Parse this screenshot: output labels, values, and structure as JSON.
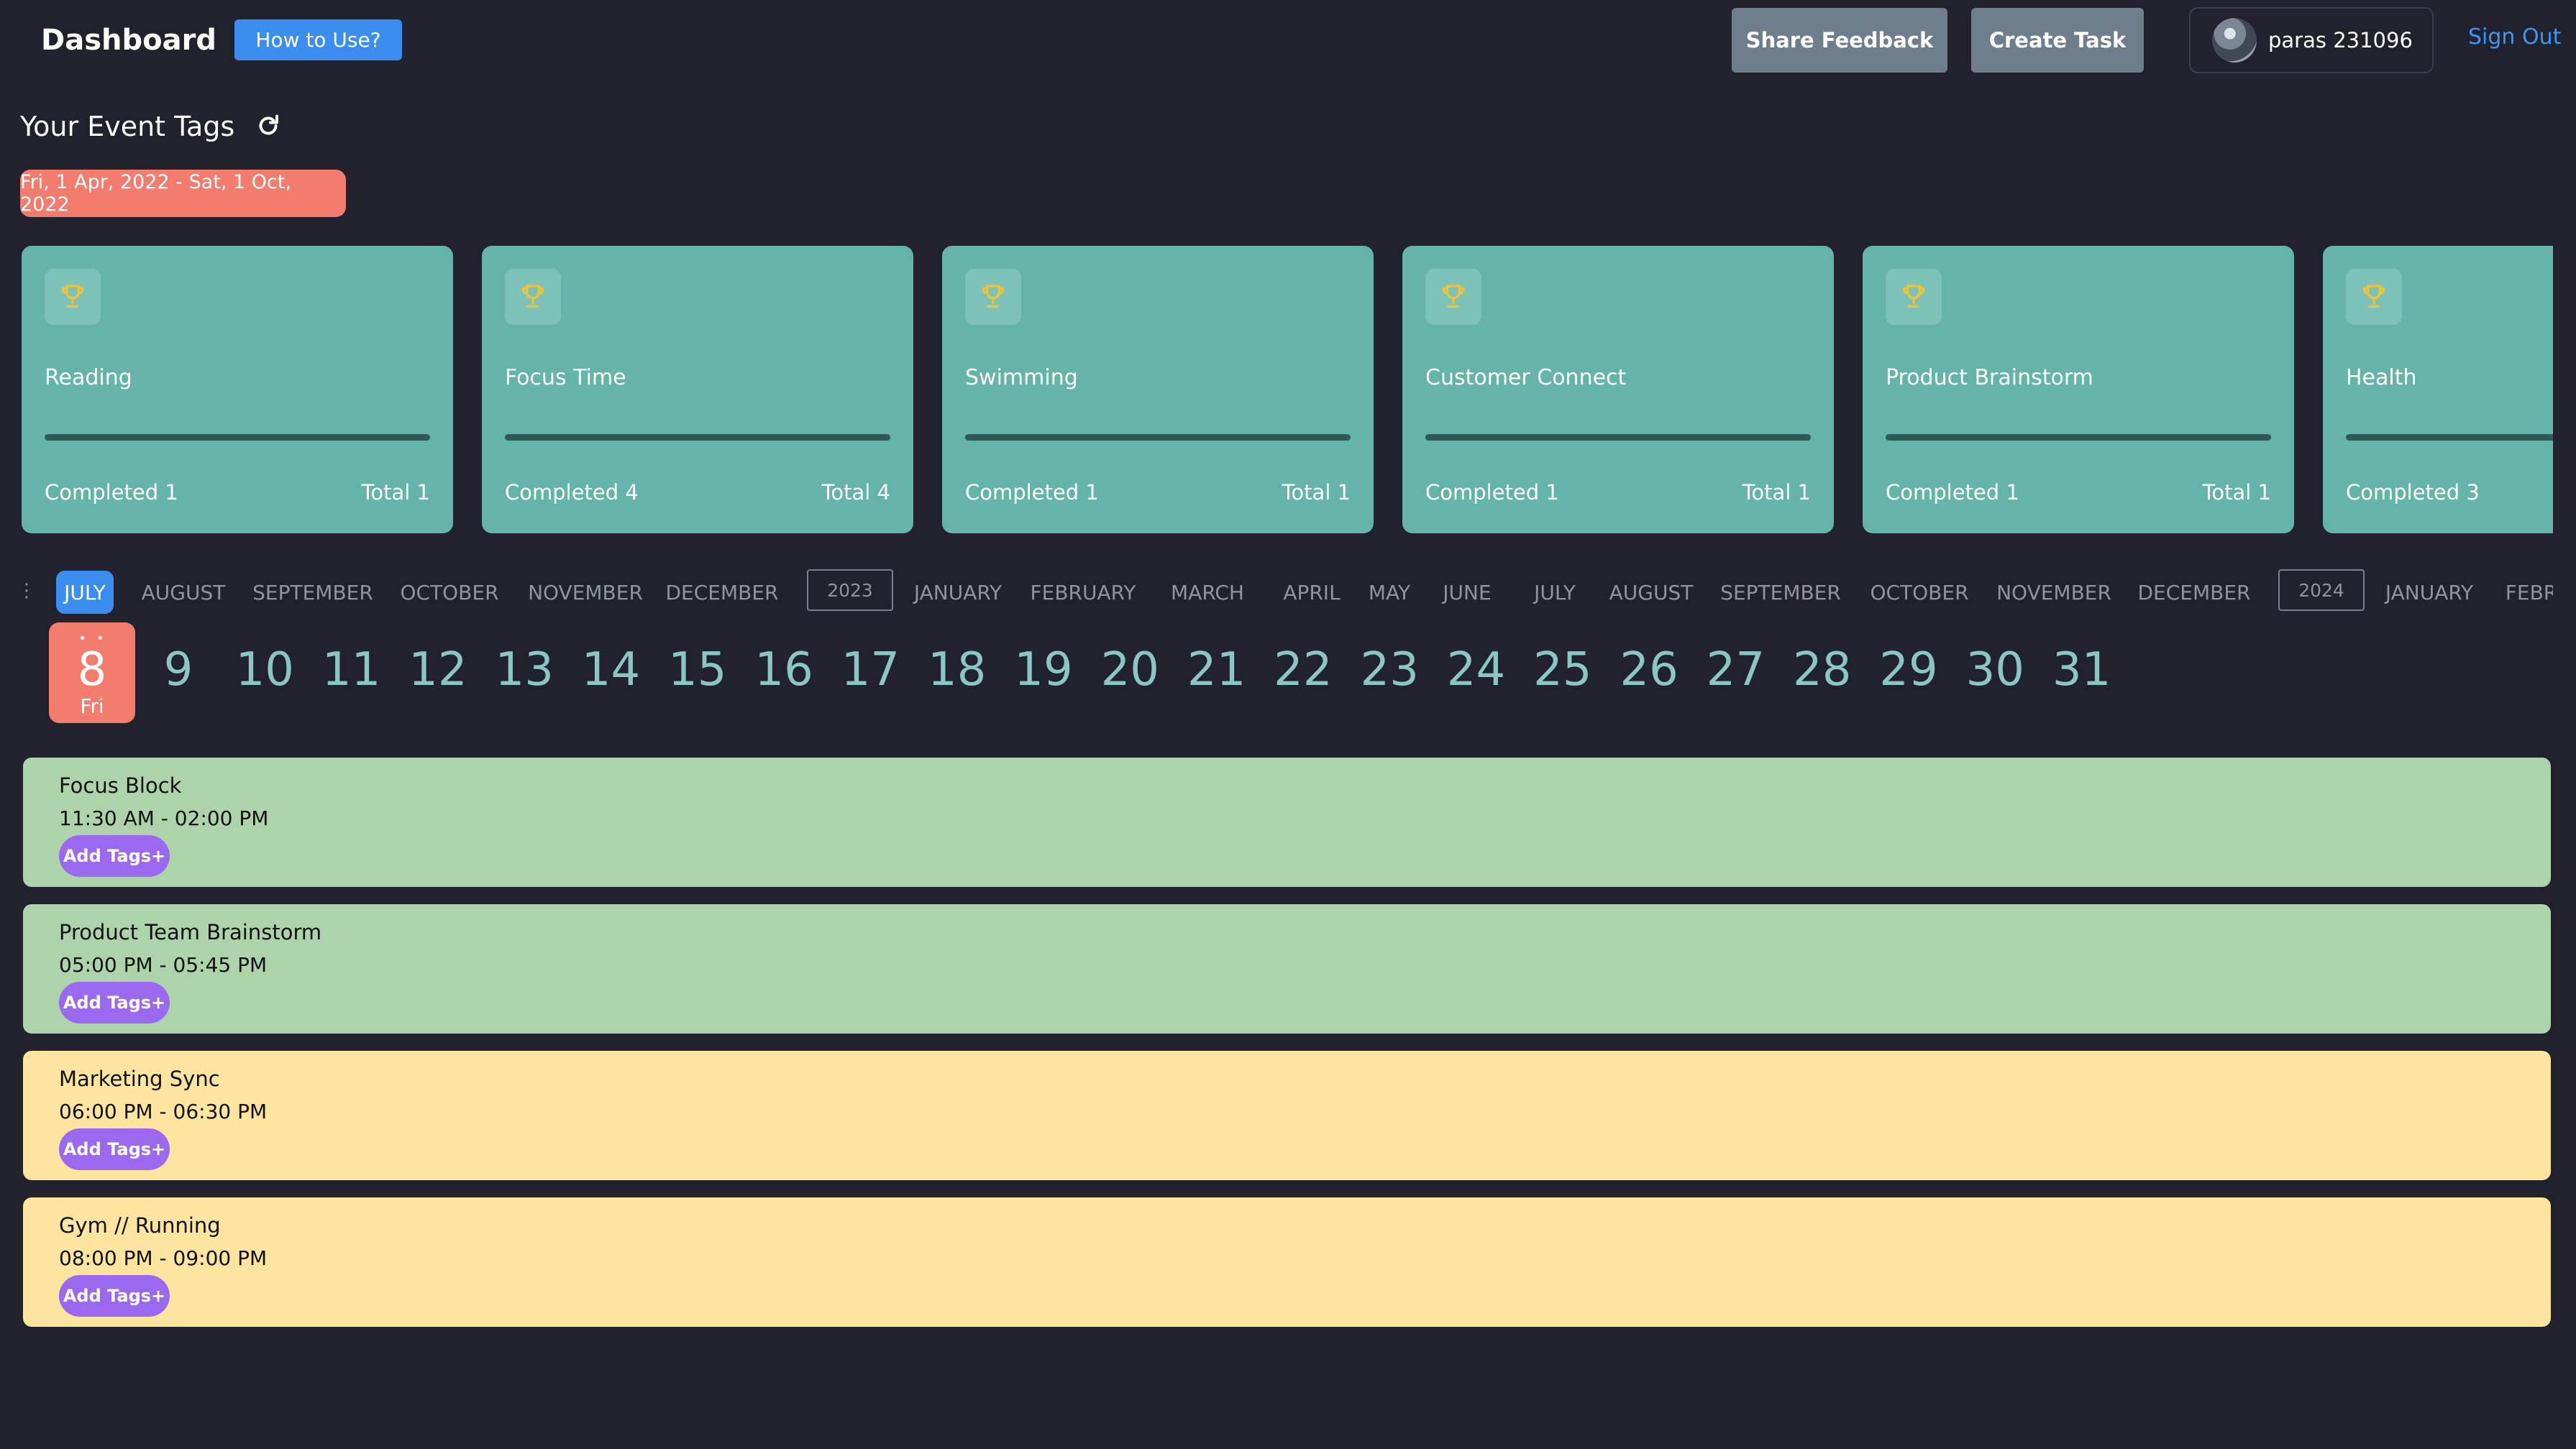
{
  "header": {
    "title": "Dashboard",
    "how_to_label": "How to Use?",
    "share_feedback_label": "Share Feedback",
    "create_task_label": "Create Task",
    "user_name": "paras 231096",
    "sign_out_label": "Sign Out"
  },
  "tags_section": {
    "title": "Your Event Tags",
    "date_range": "Fri, 1 Apr, 2022 - Sat, 1 Oct, 2022",
    "cards": [
      {
        "name": "Reading",
        "completed": "Completed 1",
        "total": "Total 1",
        "progress": 1.0
      },
      {
        "name": "Focus Time",
        "completed": "Completed 4",
        "total": "Total 4",
        "progress": 1.0
      },
      {
        "name": "Swimming",
        "completed": "Completed 1",
        "total": "Total 1",
        "progress": 1.0
      },
      {
        "name": "Customer Connect",
        "completed": "Completed 1",
        "total": "Total 1",
        "progress": 1.0
      },
      {
        "name": "Product Brainstorm",
        "completed": "Completed 1",
        "total": "Total 1",
        "progress": 1.0
      },
      {
        "name": "Health",
        "completed": "Completed 3",
        "total": "",
        "progress": 1.0
      }
    ]
  },
  "calendar": {
    "months": [
      "JULY",
      "AUGUST",
      "SEPTEMBER",
      "OCTOBER",
      "NOVEMBER",
      "DECEMBER",
      "2023",
      "JANUARY",
      "FEBRUARY",
      "MARCH",
      "APRIL",
      "MAY",
      "JUNE",
      "JULY",
      "AUGUST",
      "SEPTEMBER",
      "OCTOBER",
      "NOVEMBER",
      "DECEMBER",
      "2024",
      "JANUARY",
      "FEBR"
    ],
    "selected_day": "8",
    "selected_weekday": "Fri",
    "days": [
      "9",
      "10",
      "11",
      "12",
      "13",
      "14",
      "15",
      "16",
      "17",
      "18",
      "19",
      "20",
      "21",
      "22",
      "23",
      "24",
      "25",
      "26",
      "27",
      "28",
      "29",
      "30",
      "31"
    ]
  },
  "events": [
    {
      "title": "Focus Block",
      "time": "11:30 AM - 02:00 PM",
      "tag_button": "Add Tags+"
    },
    {
      "title": "Product Team Brainstorm",
      "time": "05:00 PM - 05:45 PM",
      "tag_button": "Add Tags+"
    },
    {
      "title": "Marketing Sync",
      "time": "06:00 PM - 06:30 PM",
      "tag_button": "Add Tags+"
    },
    {
      "title": "Gym // Running",
      "time": "08:00 PM - 09:00 PM",
      "tag_button": "Add Tags+"
    }
  ],
  "colors": {
    "background": "#22222f",
    "accent_blue": "#3b8ef0",
    "tag_card": "#65b4aa",
    "date_range": "#f27c6e",
    "event_green": "#add3aa",
    "event_yellow": "#fde49f",
    "tag_button": "#9b69f0"
  }
}
